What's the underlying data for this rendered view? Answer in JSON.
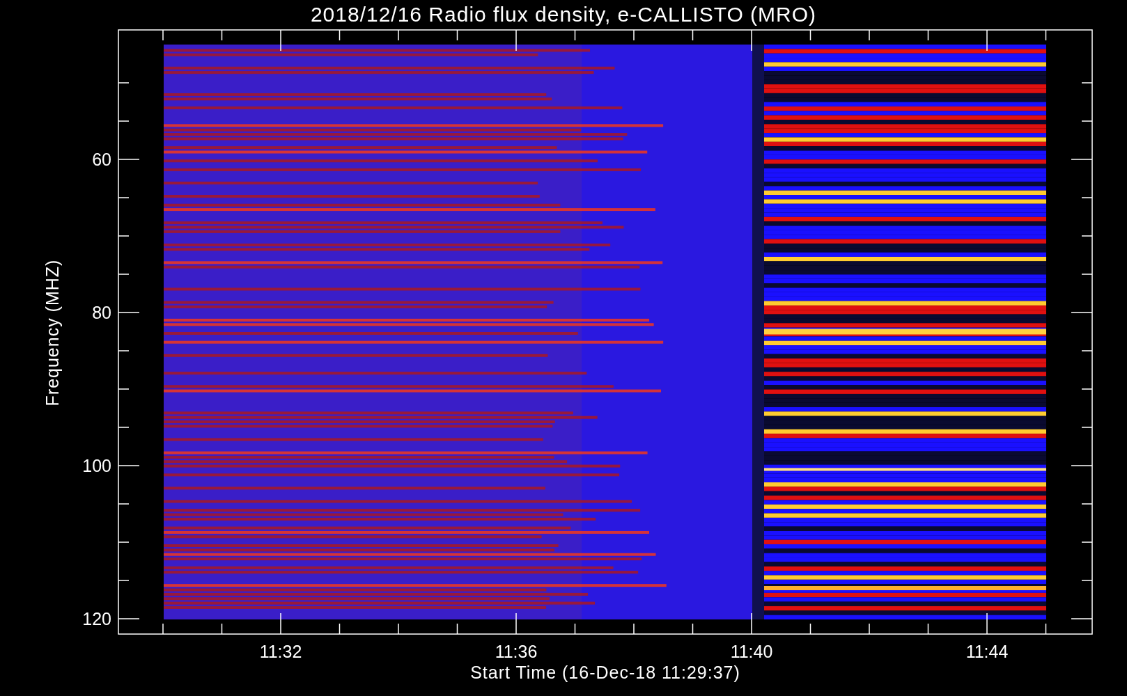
{
  "title": "2018/12/16  Radio flux density, e-CALLISTO (MRO)",
  "y_axis": {
    "label": "Frequency (MHZ)",
    "ticks": [
      "60",
      "80",
      "100",
      "120"
    ]
  },
  "x_axis": {
    "label": "Start Time (16-Dec-18 11:29:37)",
    "ticks": [
      "11:32",
      "11:36",
      "11:40",
      "11:44"
    ]
  }
}
